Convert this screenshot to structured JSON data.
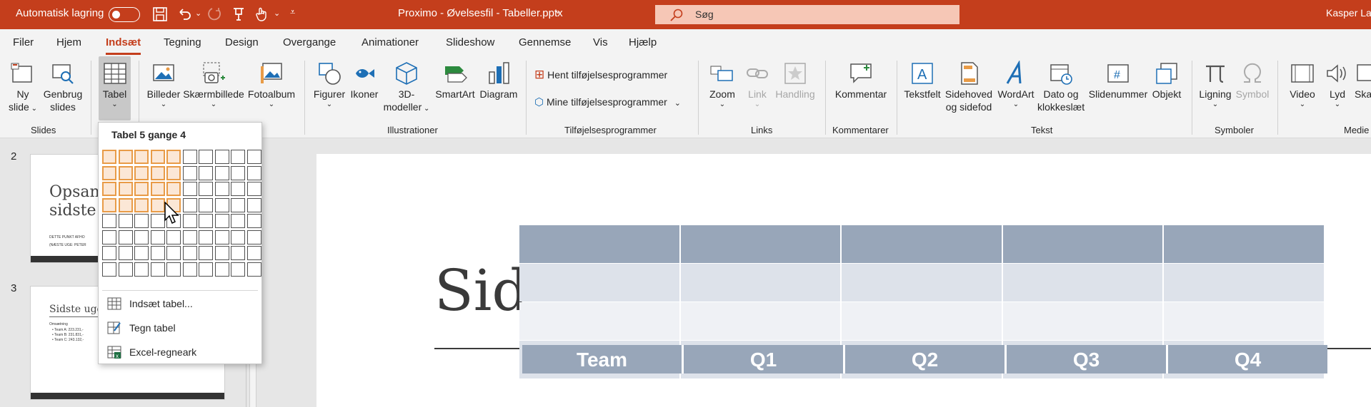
{
  "titlebar": {
    "autosave_label": "Automatisk lagring",
    "file_title": "Proximo - Øvelsesfil - Tabeller.pptx",
    "title_caret": "⌄",
    "search_placeholder": "Søg",
    "user": "Kasper Lar"
  },
  "menu": [
    "Filer",
    "Hjem",
    "Indsæt",
    "Tegning",
    "Design",
    "Overgange",
    "Animationer",
    "Slideshow",
    "Gennemse",
    "Vis",
    "Hjælp"
  ],
  "ribbon": {
    "new_slide": [
      "Ny",
      "slide"
    ],
    "reuse_slides": [
      "Genbrug",
      "slides"
    ],
    "table": "Tabel",
    "images": "Billeder",
    "screenshot": "Skærmbillede",
    "photo_album": "Fotoalbum",
    "shapes": "Figurer",
    "icons": "Ikoner",
    "models3d": [
      "3D-",
      "modeller"
    ],
    "smartart": "SmartArt",
    "chart": "Diagram",
    "get_addins": "Hent tilføjelsesprogrammer",
    "my_addins": "Mine tilføjelsesprogrammer",
    "zoom": "Zoom",
    "link": "Link",
    "action": "Handling",
    "comment": "Kommentar",
    "textbox": "Tekstfelt",
    "header_footer": [
      "Sidehoved",
      "og sidefod"
    ],
    "wordart": "WordArt",
    "date_time": [
      "Dato og",
      "klokkeslæt"
    ],
    "slide_number": "Slidenummer",
    "object": "Objekt",
    "equation": "Ligning",
    "symbol": "Symbol",
    "video": "Video",
    "audio": "Lyd",
    "screen_rec": "Ska",
    "groups": {
      "slides": "Slides",
      "illustrations": "Illustrationer",
      "addins": "Tilføjelsesprogrammer",
      "links": "Links",
      "comments": "Kommentarer",
      "text": "Tekst",
      "symbols": "Symboler",
      "media": "Medie"
    }
  },
  "table_menu": {
    "title": "Tabel 5 gange 4",
    "highlight_cols": 5,
    "highlight_rows": 4,
    "grid_cols": 10,
    "grid_rows": 8,
    "insert_table": "Indsæt tabel...",
    "draw_table": "Tegn tabel",
    "excel_sheet": "Excel-regneark"
  },
  "thumbs": [
    {
      "num": "2",
      "title_l1": "Opsan",
      "title_l2": "sidste",
      "line1": "DETTE PUNKT AFHO",
      "line2": "(NÆSTE UGE: PETER"
    },
    {
      "num": "3",
      "title": "Sidste uge",
      "sub": "Omsætning",
      "bullets": [
        "• Team A: 223.231,-",
        "• Team B: 231.831,-",
        "• Team C: 243.132,-"
      ]
    }
  ],
  "slide": {
    "title_visible": "Sid",
    "headers": [
      "Team",
      "Q1",
      "Q2",
      "Q3",
      "Q4"
    ]
  },
  "colors": {
    "accent": "#c43e1c",
    "grid_highlight": "#e89b47",
    "table_header": "#98a6b9"
  }
}
